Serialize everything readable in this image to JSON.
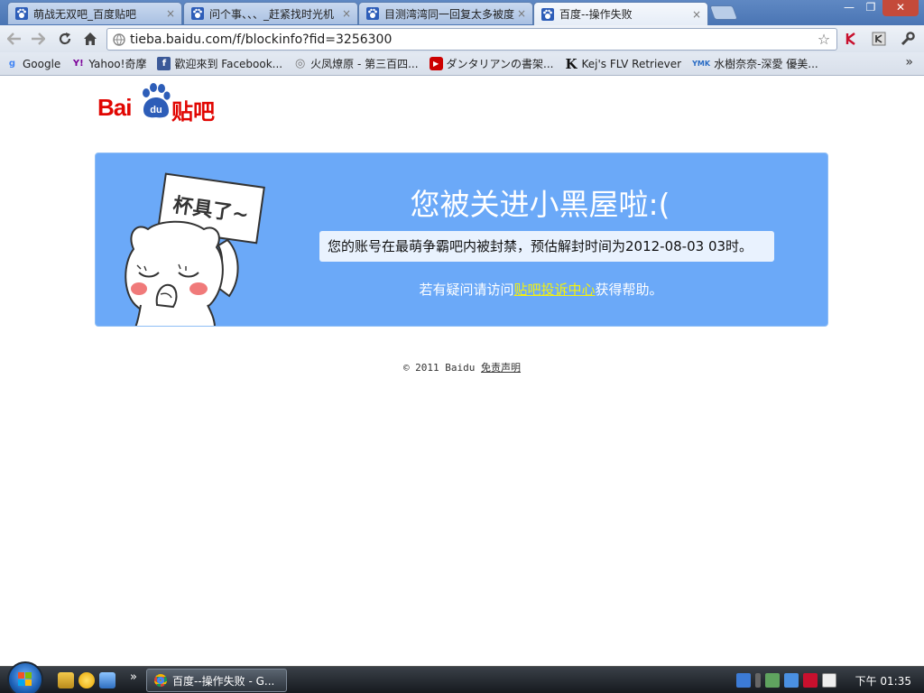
{
  "browser": {
    "tabs": [
      {
        "title": "萌战无双吧_百度贴吧",
        "active": false
      },
      {
        "title": "问个事、、、_赶紧找时光机",
        "active": false
      },
      {
        "title": "目测湾湾同一回复太多被度",
        "active": false
      },
      {
        "title": "百度--操作失败",
        "active": true
      }
    ],
    "close_glyph": "×",
    "window_controls": {
      "minimize": "—",
      "maximize": "❐",
      "close": "✕"
    },
    "url": "tieba.baidu.com/f/blockinfo?fid=3256300",
    "bookmarks": [
      {
        "label": "Google",
        "icon": "google-icon",
        "glyph": "g",
        "color": "#4285f4"
      },
      {
        "label": "Yahoo!奇摩",
        "icon": "yahoo-icon",
        "glyph": "Y!",
        "color": "#7b0099"
      },
      {
        "label": "歡迎來到 Facebook...",
        "icon": "facebook-icon",
        "glyph": "f",
        "color": "#3b5998"
      },
      {
        "label": "火凤燎原 - 第三百四...",
        "icon": "site-icon",
        "glyph": "◎",
        "color": "#777777"
      },
      {
        "label": "ダンタリアンの書架...",
        "icon": "youtube-icon",
        "glyph": "▶",
        "color": "#cc0000"
      },
      {
        "label": "Kej's FLV Retriever",
        "icon": "k-icon",
        "glyph": "K",
        "color": "#111111"
      },
      {
        "label": "水樹奈奈-深愛 優美...",
        "icon": "ymk-icon",
        "glyph": "YMK",
        "color": "#2a6cc4"
      }
    ],
    "bookmarks_more": "»"
  },
  "page": {
    "logo_text": "Bai",
    "logo_du": "du",
    "logo_tieba": "贴吧",
    "sign_text": "杯具了~",
    "heading": "您被关进小黑屋啦:(",
    "message": "您的账号在最萌争霸吧内被封禁，预估解封时间为2012-08-03 03时。",
    "help_prefix": "若有疑问请访问",
    "help_link": "贴吧投诉中心",
    "help_suffix": "获得帮助。",
    "footer_copyright": "© 2011 Baidu",
    "footer_link": "免责声明",
    "panel_color": "#6ba9f8",
    "link_color": "#f6f20a"
  },
  "taskbar": {
    "quicklaunch_more": "»",
    "window_title": "百度--操作失败 - G...",
    "clock": "下午 01:35"
  }
}
